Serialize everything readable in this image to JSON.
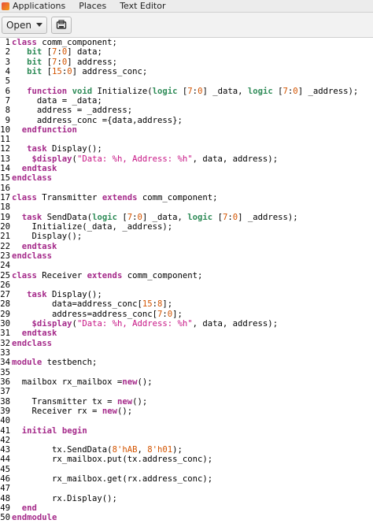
{
  "topbar": {
    "applications": "Applications",
    "places": "Places",
    "app_name": "Text Editor"
  },
  "toolbar": {
    "open_label": "Open",
    "save_icon": "save-icon"
  },
  "colors": {
    "keyword": "#a52a8a",
    "type": "#2e8b57",
    "number": "#d35400",
    "string": "#c71585"
  },
  "code_lines": [
    {
      "n": "1",
      "segs": [
        [
          "kw",
          "class"
        ],
        [
          "t",
          " comm_component;"
        ]
      ]
    },
    {
      "n": "2",
      "segs": [
        [
          "t",
          "   "
        ],
        [
          "ty",
          "bit"
        ],
        [
          "t",
          " ["
        ],
        [
          "num",
          "7"
        ],
        [
          "t",
          ":"
        ],
        [
          "num",
          "0"
        ],
        [
          "t",
          "] data;"
        ]
      ]
    },
    {
      "n": "3",
      "segs": [
        [
          "t",
          "   "
        ],
        [
          "ty",
          "bit"
        ],
        [
          "t",
          " ["
        ],
        [
          "num",
          "7"
        ],
        [
          "t",
          ":"
        ],
        [
          "num",
          "0"
        ],
        [
          "t",
          "] address;"
        ]
      ]
    },
    {
      "n": "4",
      "segs": [
        [
          "t",
          "   "
        ],
        [
          "ty",
          "bit"
        ],
        [
          "t",
          " ["
        ],
        [
          "num",
          "15"
        ],
        [
          "t",
          ":"
        ],
        [
          "num",
          "0"
        ],
        [
          "t",
          "] address_conc;"
        ]
      ]
    },
    {
      "n": "5",
      "segs": []
    },
    {
      "n": "6",
      "segs": [
        [
          "t",
          "   "
        ],
        [
          "kw",
          "function"
        ],
        [
          "t",
          " "
        ],
        [
          "ty",
          "void"
        ],
        [
          "t",
          " Initialize("
        ],
        [
          "ty",
          "logic"
        ],
        [
          "t",
          " ["
        ],
        [
          "num",
          "7"
        ],
        [
          "t",
          ":"
        ],
        [
          "num",
          "0"
        ],
        [
          "t",
          "] _data, "
        ],
        [
          "ty",
          "logic"
        ],
        [
          "t",
          " ["
        ],
        [
          "num",
          "7"
        ],
        [
          "t",
          ":"
        ],
        [
          "num",
          "0"
        ],
        [
          "t",
          "] _address);"
        ]
      ]
    },
    {
      "n": "7",
      "segs": [
        [
          "t",
          "     data = _data;"
        ]
      ]
    },
    {
      "n": "8",
      "segs": [
        [
          "t",
          "     address = _address;"
        ]
      ]
    },
    {
      "n": "9",
      "segs": [
        [
          "t",
          "     address_conc ={data,address};"
        ]
      ]
    },
    {
      "n": "10",
      "segs": [
        [
          "t",
          "  "
        ],
        [
          "kw",
          "endfunction"
        ]
      ]
    },
    {
      "n": "11",
      "segs": []
    },
    {
      "n": "12",
      "segs": [
        [
          "t",
          "   "
        ],
        [
          "kw",
          "task"
        ],
        [
          "t",
          " Display();"
        ]
      ]
    },
    {
      "n": "13",
      "segs": [
        [
          "t",
          "    "
        ],
        [
          "kw",
          "$display"
        ],
        [
          "t",
          "("
        ],
        [
          "str",
          "\"Data: %h, Address: %h\""
        ],
        [
          "t",
          ", data, address);"
        ]
      ]
    },
    {
      "n": "14",
      "segs": [
        [
          "t",
          "  "
        ],
        [
          "kw",
          "endtask"
        ]
      ]
    },
    {
      "n": "15",
      "segs": [
        [
          "kw",
          "endclass"
        ]
      ]
    },
    {
      "n": "16",
      "segs": []
    },
    {
      "n": "17",
      "segs": [
        [
          "kw",
          "class"
        ],
        [
          "t",
          " Transmitter "
        ],
        [
          "kw",
          "extends"
        ],
        [
          "t",
          " comm_component;"
        ]
      ]
    },
    {
      "n": "18",
      "segs": []
    },
    {
      "n": "19",
      "segs": [
        [
          "t",
          "  "
        ],
        [
          "kw",
          "task"
        ],
        [
          "t",
          " SendData("
        ],
        [
          "ty",
          "logic"
        ],
        [
          "t",
          " ["
        ],
        [
          "num",
          "7"
        ],
        [
          "t",
          ":"
        ],
        [
          "num",
          "0"
        ],
        [
          "t",
          "] _data, "
        ],
        [
          "ty",
          "logic"
        ],
        [
          "t",
          " ["
        ],
        [
          "num",
          "7"
        ],
        [
          "t",
          ":"
        ],
        [
          "num",
          "0"
        ],
        [
          "t",
          "] _address);"
        ]
      ]
    },
    {
      "n": "20",
      "segs": [
        [
          "t",
          "    Initialize(_data, _address);"
        ]
      ]
    },
    {
      "n": "21",
      "segs": [
        [
          "t",
          "    Display();"
        ]
      ]
    },
    {
      "n": "22",
      "segs": [
        [
          "t",
          "  "
        ],
        [
          "kw",
          "endtask"
        ]
      ]
    },
    {
      "n": "23",
      "segs": [
        [
          "kw",
          "endclass"
        ]
      ]
    },
    {
      "n": "24",
      "segs": []
    },
    {
      "n": "25",
      "segs": [
        [
          "kw",
          "class"
        ],
        [
          "t",
          " Receiver "
        ],
        [
          "kw",
          "extends"
        ],
        [
          "t",
          " comm_component;"
        ]
      ]
    },
    {
      "n": "26",
      "segs": []
    },
    {
      "n": "27",
      "segs": [
        [
          "t",
          "   "
        ],
        [
          "kw",
          "task"
        ],
        [
          "t",
          " Display();"
        ]
      ]
    },
    {
      "n": "28",
      "segs": [
        [
          "t",
          "        data=address_conc["
        ],
        [
          "num",
          "15"
        ],
        [
          "t",
          ":"
        ],
        [
          "num",
          "8"
        ],
        [
          "t",
          "];"
        ]
      ]
    },
    {
      "n": "29",
      "segs": [
        [
          "t",
          "        address=address_conc["
        ],
        [
          "num",
          "7"
        ],
        [
          "t",
          ":"
        ],
        [
          "num",
          "0"
        ],
        [
          "t",
          "];"
        ]
      ]
    },
    {
      "n": "30",
      "segs": [
        [
          "t",
          "    "
        ],
        [
          "kw",
          "$display"
        ],
        [
          "t",
          "("
        ],
        [
          "str",
          "\"Data: %h, Address: %h\""
        ],
        [
          "t",
          ", data, address);"
        ]
      ]
    },
    {
      "n": "31",
      "segs": [
        [
          "t",
          "  "
        ],
        [
          "kw",
          "endtask"
        ]
      ]
    },
    {
      "n": "32",
      "segs": [
        [
          "kw",
          "endclass"
        ]
      ]
    },
    {
      "n": "33",
      "segs": []
    },
    {
      "n": "34",
      "segs": [
        [
          "kw",
          "module"
        ],
        [
          "t",
          " testbench;"
        ]
      ]
    },
    {
      "n": "35",
      "segs": []
    },
    {
      "n": "36",
      "segs": [
        [
          "t",
          "  mailbox rx_mailbox ="
        ],
        [
          "kw",
          "new"
        ],
        [
          "t",
          "();"
        ]
      ]
    },
    {
      "n": "37",
      "segs": []
    },
    {
      "n": "38",
      "segs": [
        [
          "t",
          "    Transmitter tx = "
        ],
        [
          "kw",
          "new"
        ],
        [
          "t",
          "();"
        ]
      ]
    },
    {
      "n": "39",
      "segs": [
        [
          "t",
          "    Receiver rx = "
        ],
        [
          "kw",
          "new"
        ],
        [
          "t",
          "();"
        ]
      ]
    },
    {
      "n": "40",
      "segs": []
    },
    {
      "n": "41",
      "segs": [
        [
          "t",
          "  "
        ],
        [
          "kw",
          "initial"
        ],
        [
          "t",
          " "
        ],
        [
          "kw",
          "begin"
        ]
      ]
    },
    {
      "n": "42",
      "segs": []
    },
    {
      "n": "43",
      "segs": [
        [
          "t",
          "        tx.SendData("
        ],
        [
          "num",
          "8'hAB"
        ],
        [
          "t",
          ", "
        ],
        [
          "num",
          "8'h01"
        ],
        [
          "t",
          ");"
        ]
      ]
    },
    {
      "n": "44",
      "segs": [
        [
          "t",
          "        rx_mailbox.put(tx.address_conc);"
        ]
      ]
    },
    {
      "n": "45",
      "segs": []
    },
    {
      "n": "46",
      "segs": [
        [
          "t",
          "        rx_mailbox.get(rx.address_conc);"
        ]
      ]
    },
    {
      "n": "47",
      "segs": []
    },
    {
      "n": "48",
      "segs": [
        [
          "t",
          "        rx.Display();"
        ]
      ]
    },
    {
      "n": "49",
      "segs": [
        [
          "t",
          "  "
        ],
        [
          "kw",
          "end"
        ]
      ]
    },
    {
      "n": "50",
      "segs": [
        [
          "kw",
          "endmodule"
        ]
      ]
    }
  ]
}
